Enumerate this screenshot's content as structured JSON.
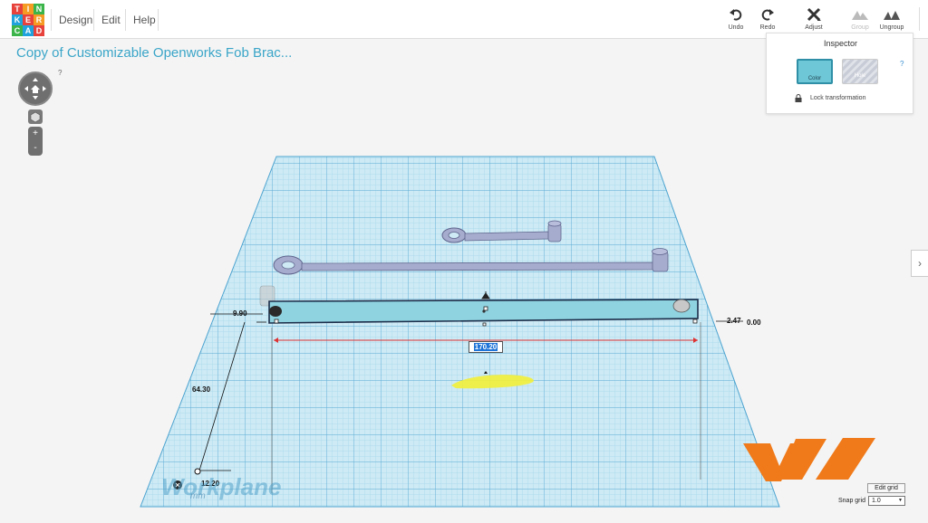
{
  "logo": {
    "letters": [
      "T",
      "I",
      "N",
      "K",
      "E",
      "R",
      "C",
      "A",
      "D"
    ],
    "colors": [
      "#e7433c",
      "#f59a23",
      "#3bb54a",
      "#20a3dc",
      "#e7433c",
      "#f59a23",
      "#3bb54a",
      "#20a3dc",
      "#e7433c"
    ]
  },
  "menu": {
    "design": "Design",
    "edit": "Edit",
    "help": "Help"
  },
  "toolbar": {
    "undo": "Undo",
    "redo": "Redo",
    "adjust": "Adjust",
    "group": "Group",
    "ungroup": "Ungroup"
  },
  "document": {
    "title": "Copy of Customizable Openworks Fob Brac...",
    "help": "?"
  },
  "view_controls": {
    "zoom_in": "+",
    "zoom_out": "-"
  },
  "inspector": {
    "title": "Inspector",
    "color": "Color",
    "hole": "Hole",
    "help": "?",
    "lock": "Lock transformation"
  },
  "side_tab": {
    "arrow": "›"
  },
  "dimensions": {
    "width": "9.90",
    "height": "2.47",
    "elevation": "0.00",
    "length": "170.20",
    "y_offset": "64.30",
    "x_offset": "12.20"
  },
  "workplane": {
    "label": "Workplane",
    "unit": "mm"
  },
  "grid": {
    "edit": "Edit grid",
    "snap_label": "Snap grid",
    "snap_value": "1.0"
  },
  "colors": {
    "accent": "#3aa5c8",
    "selected_fill": "#8fd3e0",
    "part_fill": "#a6accd",
    "watermark": "#f07a1a"
  }
}
